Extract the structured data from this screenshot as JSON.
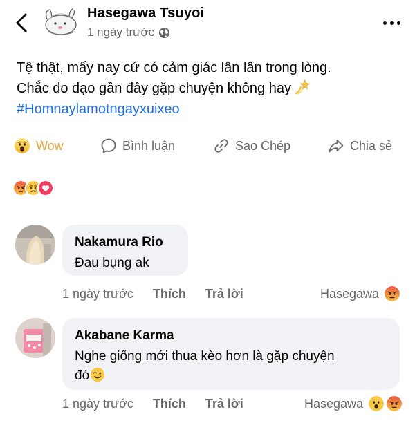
{
  "post": {
    "author": "Hasegawa Tsuyoi",
    "time": "1 ngày trước",
    "line1": "Tệ thật, mấy nay cứ có cảm giác lân lân trong lòng.",
    "line2": "Chắc do dạo gần đây gặp chuyện không hay",
    "hashtag": "#Homnaylamotngayxuixeo"
  },
  "actions": {
    "wow": "Wow",
    "comment": "Bình luận",
    "copy": "Sao Chép",
    "share": "Chia sẻ"
  },
  "colors": {
    "wow_text": "#e3a43a",
    "hashtag": "#216fdb",
    "meta": "#65676b",
    "bubble": "#f0f2f5"
  },
  "reaction_summary": [
    "angry",
    "sad",
    "love"
  ],
  "comments": [
    {
      "name": "Nakamura Rio",
      "text": "Đau bụng ak",
      "time": "1 ngày trước",
      "like": "Thích",
      "reply": "Trả lời",
      "reactor": "Hasegawa",
      "reactions": [
        "angry"
      ]
    },
    {
      "name": "Akabane Karma",
      "text_line1": "Nghe giống mới thua kèo hơn là gặp chuyện",
      "text_line2": "đó",
      "time": "1 ngày trước",
      "like": "Thích",
      "reply": "Trả lời",
      "reactor": "Hasegawa",
      "reactions": [
        "wow",
        "angry"
      ]
    }
  ]
}
